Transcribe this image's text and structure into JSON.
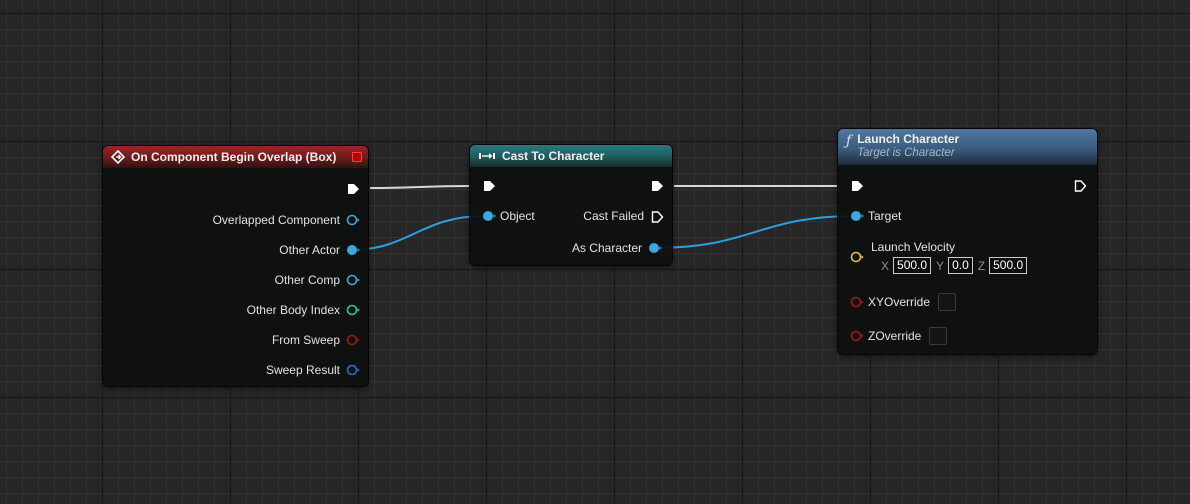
{
  "nodes": {
    "overlap": {
      "title": "On Component Begin Overlap (Box)",
      "outputs": [
        {
          "label": "Overlapped Component",
          "pin": "object-pin",
          "color": "#3aa7e0"
        },
        {
          "label": "Other Actor",
          "pin": "object-pin-connected",
          "color": "#3aa7e0"
        },
        {
          "label": "Other Comp",
          "pin": "object-pin",
          "color": "#3aa7e0"
        },
        {
          "label": "Other Body Index",
          "pin": "int-pin",
          "color": "#1ec9a0"
        },
        {
          "label": "From Sweep",
          "pin": "bool-pin",
          "color": "#a01818"
        },
        {
          "label": "Sweep Result",
          "pin": "struct-pin",
          "color": "#1e6fd0"
        }
      ]
    },
    "cast": {
      "title": "Cast To Character",
      "input_object": "Object",
      "cast_failed": "Cast Failed",
      "as_character": "As Character"
    },
    "launch": {
      "title": "Launch Character",
      "subtitle": "Target is Character",
      "target": "Target",
      "velocity_label": "Launch Velocity",
      "velocity": {
        "x_label": "X",
        "x": "500.0",
        "y_label": "Y",
        "y": "0.0",
        "z_label": "Z",
        "z": "500.0"
      },
      "xy_override": "XYOverride",
      "z_override": "ZOverride"
    }
  },
  "colors": {
    "exec": "#ffffff",
    "object": "#3aa7e0",
    "vector": "#e8c13a",
    "bool": "#a01818",
    "int": "#1ec9a0",
    "struct": "#1e6fd0",
    "event_header": "#8b2222",
    "cast_header": "#2a7a7e",
    "function_header": "#4f77a0"
  }
}
